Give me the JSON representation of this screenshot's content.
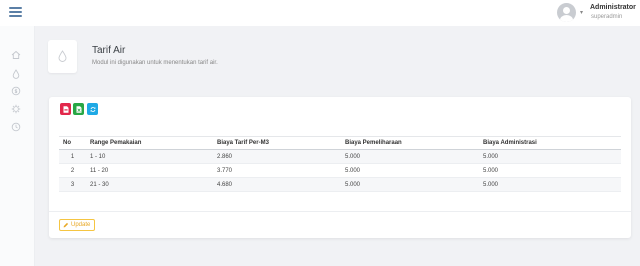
{
  "topbar": {
    "menu_icon": "hamburger-icon",
    "user": {
      "name": "Administrator",
      "role": "superadmin",
      "avatar_icon": "user-avatar-icon"
    }
  },
  "sidebar": {
    "icons": [
      "home-icon",
      "drop-icon",
      "money-icon",
      "gear-icon",
      "clock-icon"
    ]
  },
  "header": {
    "icon": "water-drop-icon",
    "title": "Tarif Air",
    "subtitle": "Modul ini digunakan untuk menentukan tarif air."
  },
  "toolbar": {
    "buttons": [
      {
        "icon": "file-pdf-icon",
        "color": "#e2284b"
      },
      {
        "icon": "file-excel-icon",
        "color": "#28a745"
      },
      {
        "icon": "refresh-icon",
        "color": "#1ea9e5"
      }
    ]
  },
  "table": {
    "columns": [
      "No",
      "Range Pemakaian",
      "Biaya Tarif Per-M3",
      "Biaya Pemeliharaan",
      "Biaya Administrasi"
    ],
    "rows": [
      [
        "1",
        "1 - 10",
        "2.860",
        "5.000",
        "5.000"
      ],
      [
        "2",
        "11 - 20",
        "3.770",
        "5.000",
        "5.000"
      ],
      [
        "3",
        "21 - 30",
        "4.680",
        "5.000",
        "5.000"
      ]
    ]
  },
  "footer": {
    "update_label": "Update",
    "update_icon": "pencil-icon"
  },
  "colors": {
    "accent": "#5b7fa6",
    "danger": "#e2284b",
    "success": "#28a745",
    "info": "#1ea9e5",
    "warning": "#f5c542"
  }
}
